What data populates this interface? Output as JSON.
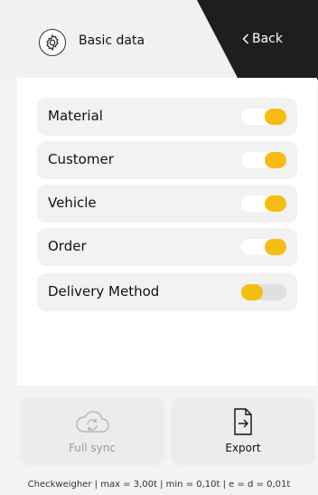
{
  "header": {
    "title": "Basic data",
    "back_label": "Back"
  },
  "settings": [
    {
      "label": "Material",
      "enabled": true
    },
    {
      "label": "Customer",
      "enabled": true
    },
    {
      "label": "Vehicle",
      "enabled": true
    },
    {
      "label": "Order",
      "enabled": true
    },
    {
      "label": "Delivery Method",
      "enabled": false
    }
  ],
  "actions": {
    "sync_label": "Full sync",
    "export_label": "Export"
  },
  "status_bar": "Checkweigher | max = 3,00t | min = 0,10t | e = d = 0,01t",
  "colors": {
    "accent": "#f5bd14",
    "header_dark": "#1e1e1e"
  },
  "icons": {
    "header": "settings-gear-icon",
    "back": "chevron-left-icon",
    "sync": "cloud-sync-icon",
    "export": "export-file-icon"
  }
}
